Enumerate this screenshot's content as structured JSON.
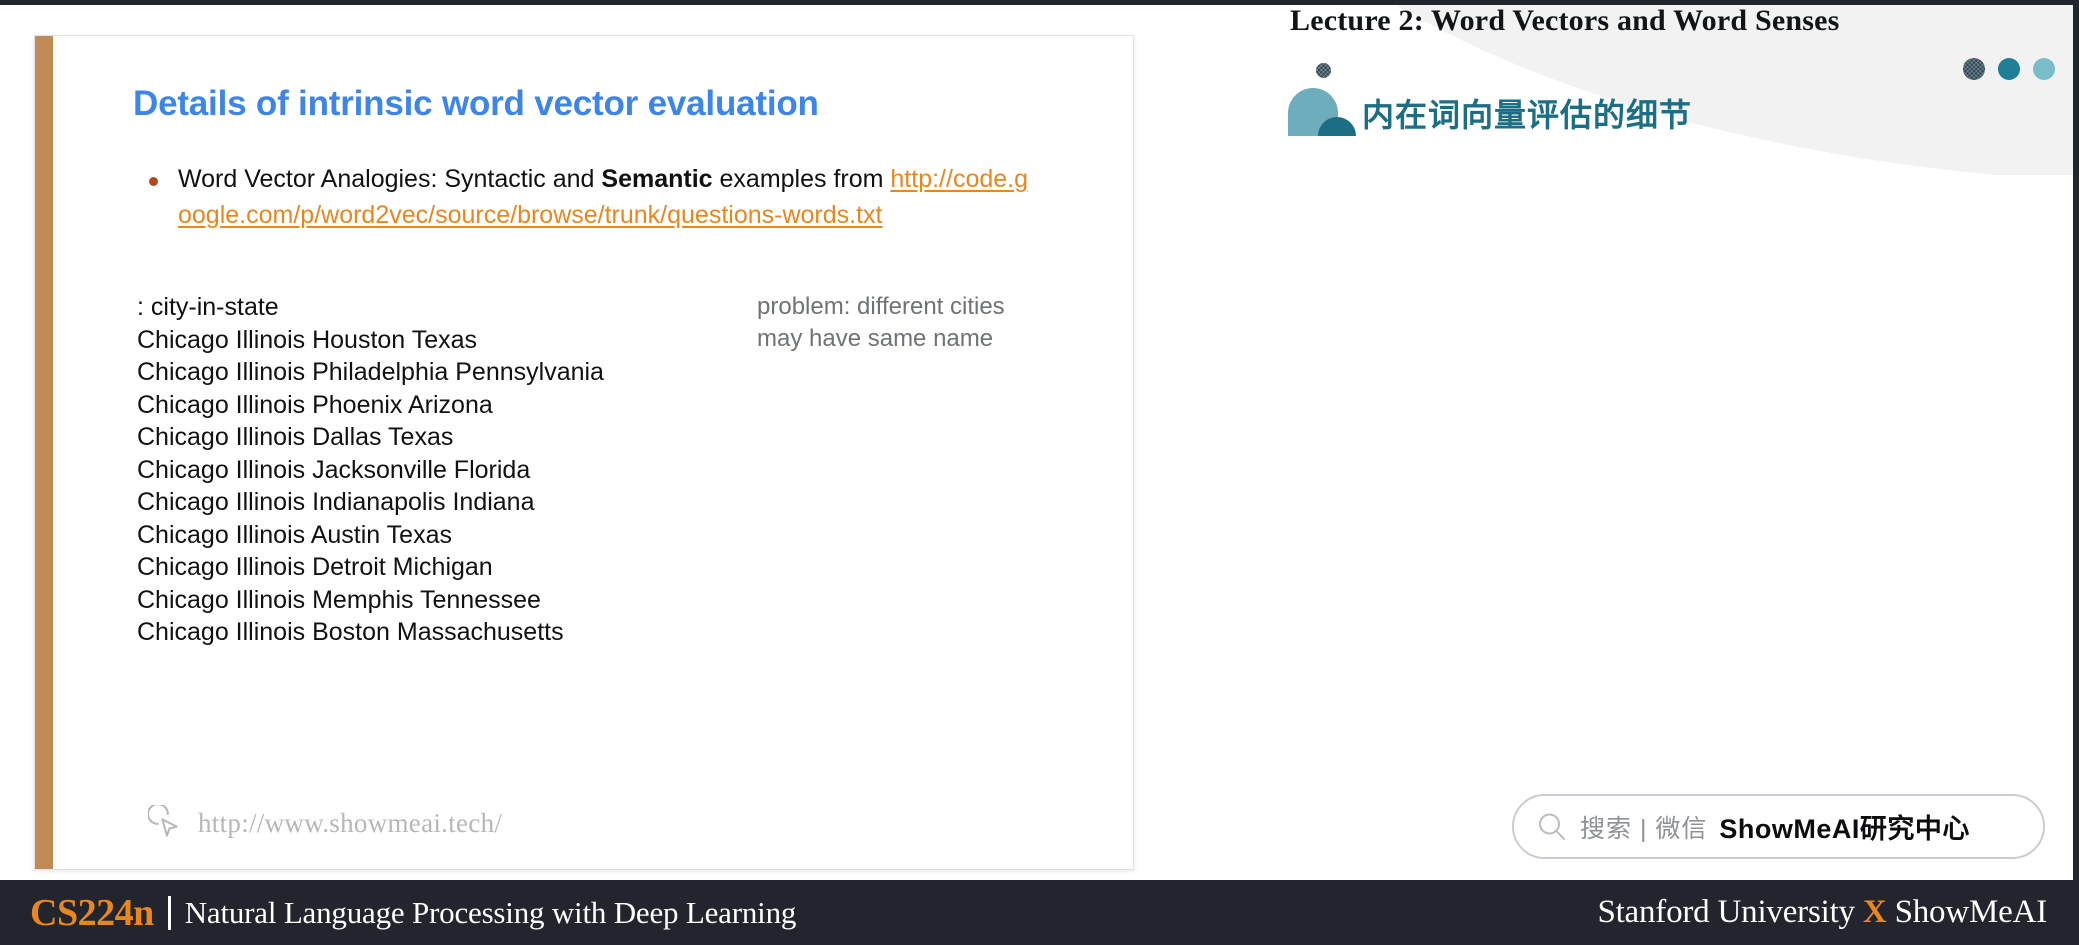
{
  "header": {
    "lecture_title": "Lecture 2:  Word Vectors and Word Senses",
    "chinese_title": "内在词向量评估的细节",
    "logo_icon": "showmeai-quarter-circle-logo",
    "dots": [
      "dot-dark-textured",
      "dot-teal",
      "dot-light-teal"
    ],
    "accent_color": "#1b6e83"
  },
  "slide": {
    "title": "Details of intrinsic word vector evaluation",
    "title_color": "#3d85e8",
    "accent_bar_color": "#c08b55",
    "bullet": {
      "text_before_bold": "Word Vector Analogies: Syntactic and ",
      "bold_word": "Semantic",
      "text_after_bold": " examples from ",
      "url": "http://code.google.com/p/word2vec/source/browse/trunk/questions-words.txt",
      "url_color": "#e8871e",
      "bullet_icon": "bullet-dot"
    },
    "data_list": [
      ": city-in-state",
      "Chicago Illinois Houston Texas",
      "Chicago Illinois Philadelphia Pennsylvania",
      "Chicago Illinois Phoenix Arizona",
      "Chicago Illinois Dallas Texas",
      "Chicago Illinois Jacksonville Florida",
      "Chicago Illinois Indianapolis Indiana",
      "Chicago Illinois Austin Texas",
      "Chicago Illinois Detroit Michigan",
      "Chicago Illinois Memphis Tennessee",
      "Chicago Illinois Boston Massachusetts"
    ],
    "note_line1": "problem: different cities",
    "note_line2": "may have same name",
    "watermark": {
      "icon": "cursor-pointer-icon",
      "text": "http://www.showmeai.tech/"
    }
  },
  "search_pill": {
    "icon": "search-icon",
    "gray_text": "搜索 | 微信",
    "bold_text": "ShowMeAI研究中心"
  },
  "footer": {
    "course_code": "CS224n",
    "course_name": "Natural Language Processing with Deep Learning",
    "right_before": "Stanford University ",
    "right_x": "X",
    "right_after": " ShowMeAI",
    "accent_color": "#e8871e",
    "background": "#22242e"
  }
}
